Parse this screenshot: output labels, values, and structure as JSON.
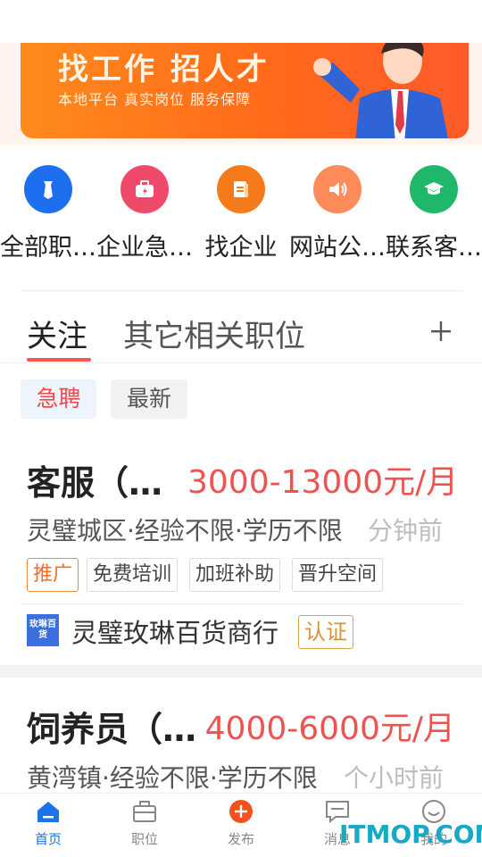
{
  "banner": {
    "title": "找工作 招人才",
    "subtitle": "本地平台 真实岗位 服务保障"
  },
  "nav": [
    {
      "label": "全部职…",
      "icon": "tie-icon",
      "color": "#1e6ff0"
    },
    {
      "label": "企业急…",
      "icon": "briefcase-icon",
      "color": "#f04a6a"
    },
    {
      "label": "找企业",
      "icon": "document-icon",
      "color": "#f57a1a"
    },
    {
      "label": "网站公…",
      "icon": "speaker-icon",
      "color": "#ff8a5a"
    },
    {
      "label": "联系客…",
      "icon": "graduation-cap-icon",
      "color": "#1fb86a"
    }
  ],
  "tabs": {
    "active": "关注",
    "other": "其它相关职位"
  },
  "filters": {
    "urgent": "急聘",
    "newest": "最新"
  },
  "jobs": [
    {
      "title": "客服（…",
      "salary": "3000-13000元/月",
      "meta": "灵璧城区·经验不限·学历不限",
      "time": "分钟前",
      "tags": [
        "推广",
        "免费培训",
        "加班补助",
        "晋升空间"
      ],
      "company_logo_text": "玫琳百货",
      "company": "灵璧玫琳百货商行",
      "badge": "认证"
    },
    {
      "title": "饲养员（…",
      "salary": "4000-6000元/月",
      "meta": "黄湾镇·经验不限·学历不限",
      "time": "个小时前"
    }
  ],
  "bottom_nav": [
    {
      "label": "首页",
      "icon": "home-icon"
    },
    {
      "label": "职位",
      "icon": "briefcase-icon"
    },
    {
      "label": "发布",
      "icon": "plus-circle-icon"
    },
    {
      "label": "消息",
      "icon": "message-icon"
    },
    {
      "label": "我的",
      "icon": "smiley-icon"
    }
  ],
  "watermark": "ITMOP.COM",
  "colors": {
    "accent_red": "#ef5350",
    "brand_blue": "#1a73e8",
    "banner_orange": "#ff6a1a"
  }
}
